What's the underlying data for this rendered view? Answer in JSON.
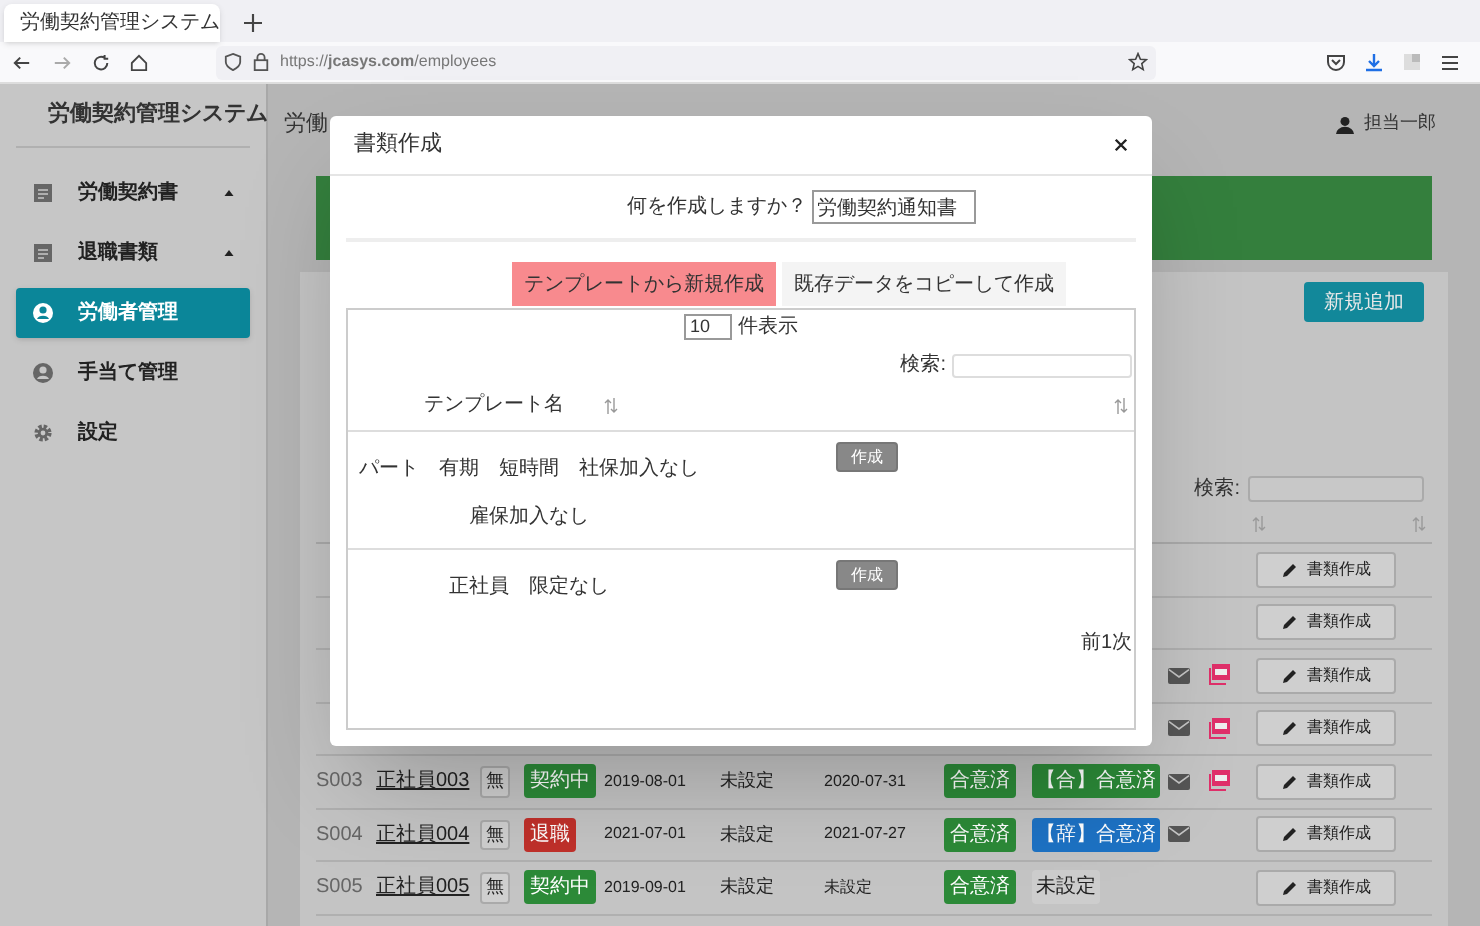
{
  "browser": {
    "tab_title": "労働契約管理システム",
    "url": "https://**jcasys.com**/employees"
  },
  "sidebar": {
    "app_title": "労働契約管理システム",
    "items": [
      {
        "label": "労働契約書",
        "kind": "document",
        "expandable": true,
        "selected": false
      },
      {
        "label": "退職書類",
        "kind": "document",
        "expandable": true,
        "selected": false
      },
      {
        "label": "労働者管理",
        "kind": "person",
        "expandable": false,
        "selected": true
      },
      {
        "label": "手当て管理",
        "kind": "person",
        "expandable": false,
        "selected": false
      },
      {
        "label": "設定",
        "kind": "settings",
        "expandable": false,
        "selected": false
      }
    ]
  },
  "header": {
    "page_title": "労働",
    "user": "担当一郎"
  },
  "main": {
    "add_button": "新規追加",
    "search_label": "検索:",
    "rows": [
      {
        "mail": false,
        "pdf": false,
        "action": "書類作成"
      },
      {
        "mail": false,
        "pdf": false,
        "action": "書類作成"
      },
      {
        "mail": true,
        "pdf": true,
        "action": "書類作成"
      },
      {
        "mail": true,
        "pdf": true,
        "action": "書類作成"
      },
      {
        "id": "S003",
        "name": "正社員003",
        "insurance": "無",
        "status": {
          "text": "契約中",
          "color": "#2c8a38"
        },
        "start": "2019-08-01",
        "date_2": "未設定",
        "end": "2020-07-31",
        "consent": "合意済",
        "agreement": {
          "text": "【合】合意済",
          "color": "#2c8a38"
        },
        "mail": true,
        "pdf": true,
        "action": "書類作成"
      },
      {
        "id": "S004",
        "name": "正社員004",
        "insurance": "無",
        "status": {
          "text": "退職",
          "color": "#c0302a"
        },
        "start": "2021-07-01",
        "date_2": "未設定",
        "end": "2021-07-27",
        "consent": "合意済",
        "agreement": {
          "text": "【辞】合意済",
          "color": "#1d72c4"
        },
        "mail": true,
        "pdf": false,
        "action": "書類作成"
      },
      {
        "id": "S005",
        "name": "正社員005",
        "insurance": "無",
        "status": {
          "text": "契約中",
          "color": "#2c8a38"
        },
        "start": "2019-09-01",
        "date_2": "未設定",
        "end": "未設定",
        "consent": "合意済",
        "agreement": {
          "text": "未設定"
        },
        "mail": false,
        "pdf": false,
        "action": "書類作成"
      }
    ]
  },
  "modal": {
    "title": "書類作成",
    "question": "何を作成しますか？",
    "doc_type": "労働契約通知書",
    "tabs": [
      {
        "label": "テンプレートから新規作成",
        "selected": true
      },
      {
        "label": "既存データをコピーして作成",
        "selected": false
      }
    ],
    "page_size": "10",
    "page_size_label": "件表示",
    "search_label": "検索:",
    "column": "テンプレート名",
    "templates": [
      {
        "name": "パート　有期　短時間　社保加入なし雇保加入なし",
        "button": "作成"
      },
      {
        "name": "正社員　限定なし",
        "button": "作成"
      }
    ],
    "pagination": {
      "prev": "前",
      "page": "1",
      "next": "次"
    }
  }
}
